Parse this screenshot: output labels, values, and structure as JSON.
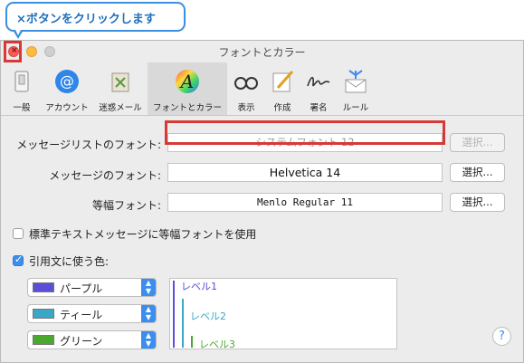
{
  "callout": {
    "text": "×ボタンをクリックします"
  },
  "window": {
    "title": "フォントとカラー"
  },
  "toolbar": {
    "items": [
      {
        "label": "一般",
        "icon": "switch-icon"
      },
      {
        "label": "アカウント",
        "icon": "at-sign-icon"
      },
      {
        "label": "迷惑メール",
        "icon": "trash-icon"
      },
      {
        "label": "フォントとカラー",
        "icon": "font-icon",
        "selected": true
      },
      {
        "label": "表示",
        "icon": "glasses-icon"
      },
      {
        "label": "作成",
        "icon": "pencil-icon"
      },
      {
        "label": "署名",
        "icon": "signature-icon"
      },
      {
        "label": "ルール",
        "icon": "envelope-rules-icon"
      }
    ]
  },
  "fonts": {
    "message_list_label": "メッセージリストのフォント:",
    "message_list_value": "システムフォント 12",
    "message_label": "メッセージのフォント:",
    "message_value": "Helvetica 14",
    "fixed_label": "等幅フォント:",
    "fixed_value": "Menlo Regular 11",
    "select_button": "選択..."
  },
  "options": {
    "use_fixed_width": "標準テキストメッセージに等幅フォントを使用",
    "quoted_text_colors": "引用文に使う色:"
  },
  "quote_colors": [
    {
      "name": "パープル",
      "color": "#5a4fd6"
    },
    {
      "name": "ティール",
      "color": "#3aa7c9"
    },
    {
      "name": "グリーン",
      "color": "#4aa82e"
    }
  ],
  "preview": {
    "level1": "レベル1",
    "level2": "レベル2",
    "level3": "レベル3"
  },
  "help": {
    "symbol": "?"
  },
  "colors": {
    "highlight": "#d63a36",
    "accent": "#3b8ef0",
    "callout": "#3a8fe0"
  }
}
